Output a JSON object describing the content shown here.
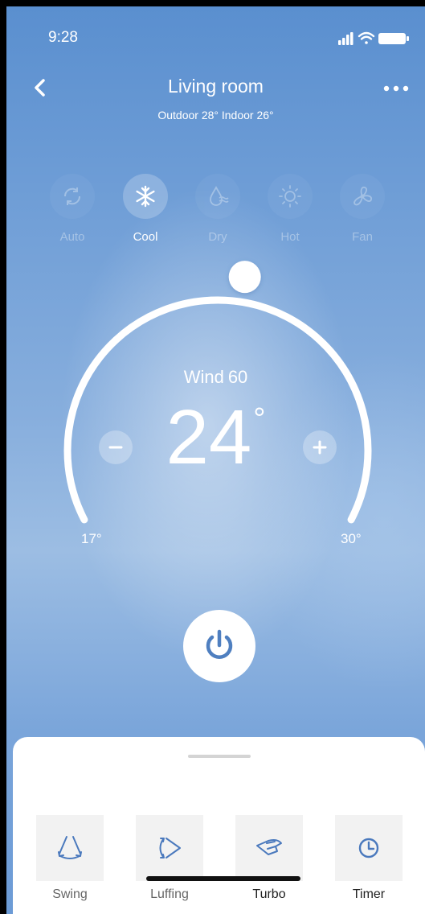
{
  "status": {
    "time": "9:28"
  },
  "header": {
    "title": "Living room",
    "subtitle": "Outdoor 28° Indoor 26°"
  },
  "modes": [
    {
      "label": "Auto",
      "icon": "refresh-icon",
      "active": false
    },
    {
      "label": "Cool",
      "icon": "snowflake-icon",
      "active": true
    },
    {
      "label": "Dry",
      "icon": "droplet-icon",
      "active": false
    },
    {
      "label": "Hot",
      "icon": "sun-icon",
      "active": false
    },
    {
      "label": "Fan",
      "icon": "fan-icon",
      "active": false
    }
  ],
  "thermostat": {
    "wind_label": "Wind",
    "wind_value": "60",
    "temperature": "24",
    "degree": "°",
    "min_label": "17°",
    "max_label": "30°",
    "min": 17,
    "max": 30,
    "setpoint": 24
  },
  "features": [
    {
      "label": "Swing",
      "icon": "swing-icon"
    },
    {
      "label": "Luffing",
      "icon": "luffing-icon"
    },
    {
      "label": "Turbo",
      "icon": "turbo-icon"
    },
    {
      "label": "Timer",
      "icon": "clock-icon"
    }
  ],
  "colors": {
    "accent": "#4f7fc0",
    "background_top": "#5a8fcf",
    "sheet": "#ffffff"
  }
}
